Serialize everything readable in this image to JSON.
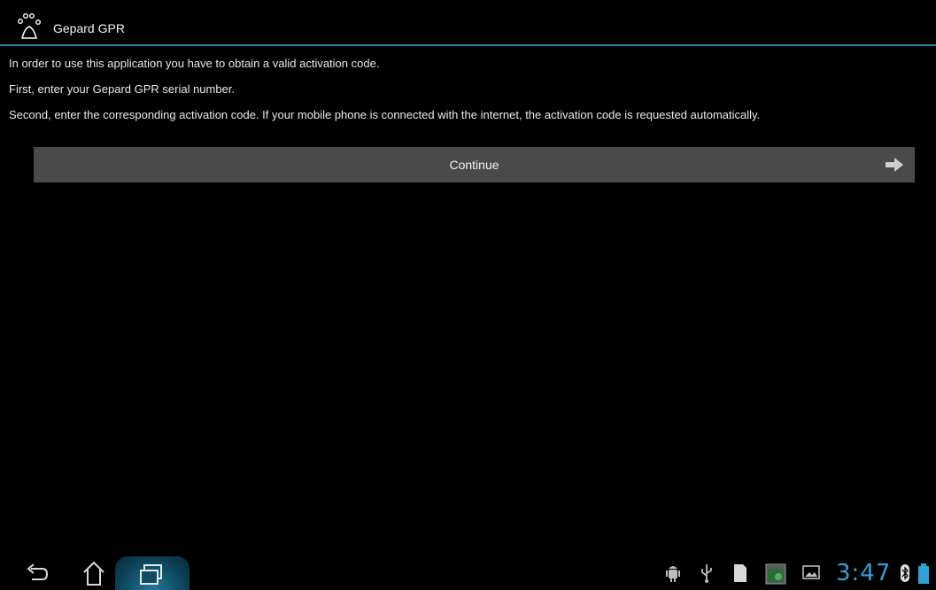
{
  "app": {
    "title": "Gepard GPR"
  },
  "messages": {
    "line1": "In order to use this application you have to obtain a valid activation code.",
    "line2": "First, enter your Gepard GPR serial number.",
    "line3": "Second, enter the corresponding activation code. If your mobile phone is connected with the internet, the activation code is requested automatically."
  },
  "continue_button": {
    "label": "Continue",
    "icon": "arrow-right-icon"
  },
  "system_bar": {
    "back_icon": "back-icon",
    "home_icon": "home-icon",
    "recent_icon": "recent-apps-icon",
    "status_icons": [
      "android-debug-icon",
      "usb-icon",
      "sd-card-icon",
      "screenshot-icon",
      "gallery-icon",
      "bluetooth-icon",
      "battery-icon"
    ],
    "clock": "3:47"
  },
  "colors": {
    "accent": "#2a79a6",
    "clock": "#2fa2d4",
    "button_bg": "#4a4a4a",
    "battery": "#2fa2d4"
  }
}
